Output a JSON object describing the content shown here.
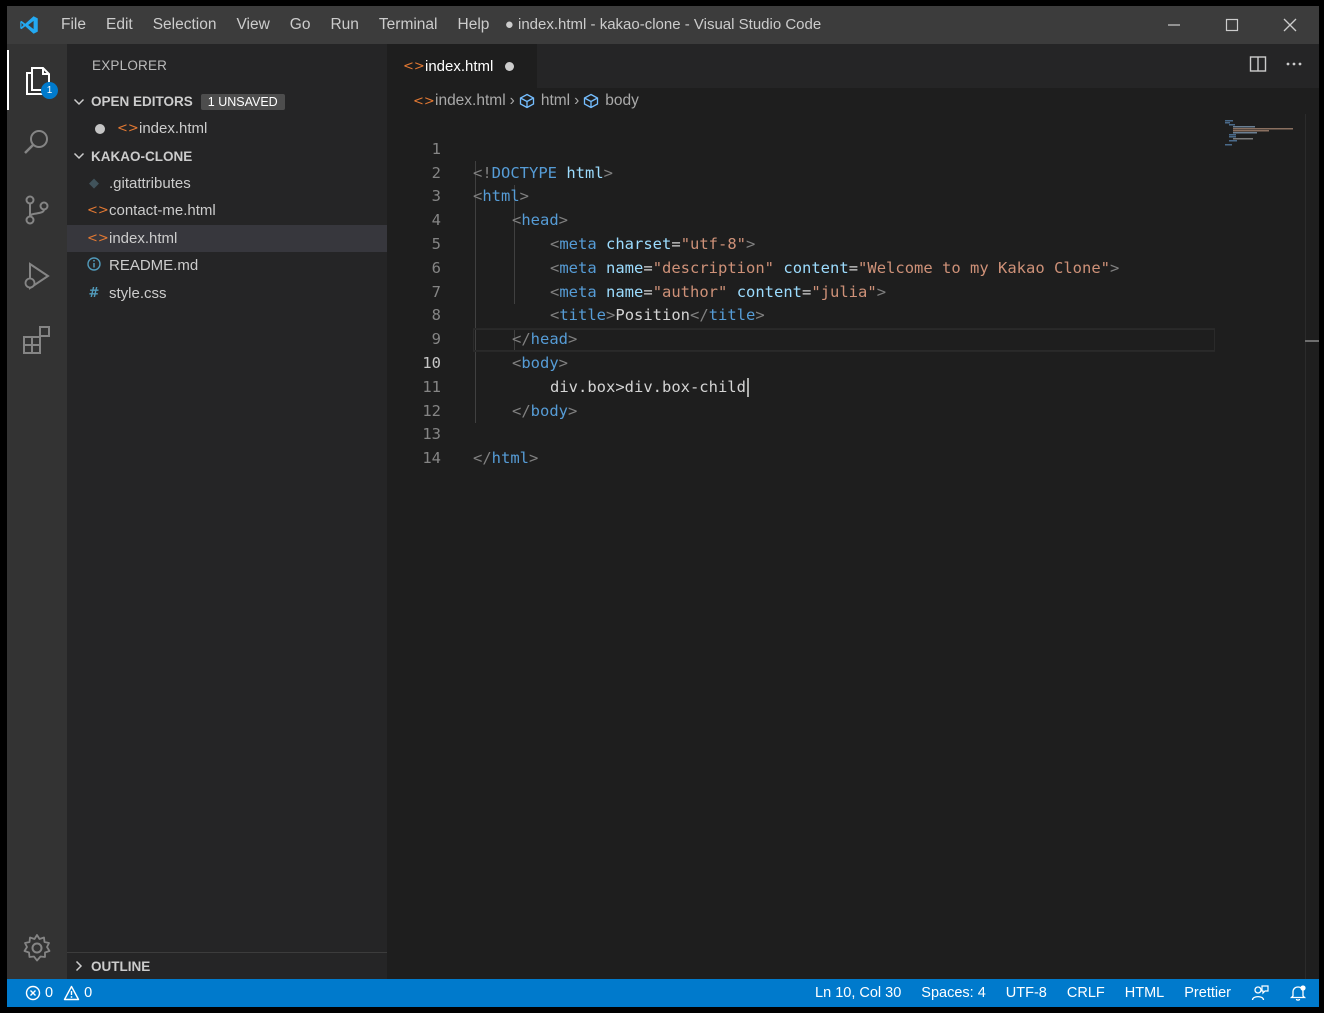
{
  "titlebar": {
    "title": "● index.html - kakao-clone - Visual Studio Code",
    "menu": [
      "File",
      "Edit",
      "Selection",
      "View",
      "Go",
      "Run",
      "Terminal",
      "Help"
    ],
    "controls": [
      "minimize-icon",
      "maximize-icon",
      "close-icon"
    ]
  },
  "activitybar": {
    "items": [
      {
        "name": "explorer-icon",
        "badge": "1",
        "active": true
      },
      {
        "name": "search-icon"
      },
      {
        "name": "source-control-icon"
      },
      {
        "name": "run-debug-icon"
      },
      {
        "name": "extensions-icon"
      }
    ],
    "bottom": {
      "name": "settings-gear-icon"
    }
  },
  "sidebar": {
    "title": "EXPLORER",
    "open_editors": {
      "label": "OPEN EDITORS",
      "badge": "1 UNSAVED",
      "items": [
        {
          "name": "index.html",
          "icon": "html-icon",
          "modified": true
        }
      ]
    },
    "project": {
      "label": "KAKAO-CLONE",
      "files": [
        {
          "name": ".gitattributes",
          "icon": "git-icon",
          "color": "#41535b"
        },
        {
          "name": "contact-me.html",
          "icon": "html-icon",
          "color": "#e37933"
        },
        {
          "name": "index.html",
          "icon": "html-icon",
          "color": "#e37933",
          "selected": true
        },
        {
          "name": "README.md",
          "icon": "info-icon",
          "color": "#519aba"
        },
        {
          "name": "style.css",
          "icon": "css-icon",
          "color": "#519aba"
        }
      ]
    },
    "outline": {
      "label": "OUTLINE"
    }
  },
  "editor": {
    "tab": {
      "label": "index.html",
      "modified": true
    },
    "breadcrumb": [
      "index.html",
      "html",
      "body"
    ],
    "current_line": 10,
    "lines": [
      {
        "n": "1"
      },
      {
        "n": "2"
      },
      {
        "n": "3"
      },
      {
        "n": "4"
      },
      {
        "n": "5"
      },
      {
        "n": "6"
      },
      {
        "n": "7"
      },
      {
        "n": "8"
      },
      {
        "n": "9"
      },
      {
        "n": "10"
      },
      {
        "n": "11"
      },
      {
        "n": "12"
      },
      {
        "n": "13"
      },
      {
        "n": "14"
      }
    ],
    "code": {
      "l1": [
        "<!",
        "DOCTYPE",
        " ",
        "html",
        ">"
      ],
      "l2": [
        "<",
        "html",
        ">"
      ],
      "l3": [
        "<",
        "head",
        ">"
      ],
      "l4": [
        "<",
        "meta",
        " ",
        "charset",
        "=",
        "\"utf-8\"",
        ">"
      ],
      "l5": [
        "<",
        "meta",
        " ",
        "name",
        "=",
        "\"description\"",
        " ",
        "content",
        "=",
        "\"Welcome to my Kakao Clone\"",
        ">"
      ],
      "l6": [
        "<",
        "meta",
        " ",
        "name",
        "=",
        "\"author\"",
        " ",
        "content",
        "=",
        "\"julia\"",
        ">"
      ],
      "l7": [
        "<",
        "title",
        ">",
        "Position",
        "</",
        "title",
        ">"
      ],
      "l8": [
        "</",
        "head",
        ">"
      ],
      "l9": [
        "<",
        "body",
        ">"
      ],
      "l10": [
        "div.box>div.box-child"
      ],
      "l11": [
        "</",
        "body",
        ">"
      ],
      "l13": [
        "</",
        "html",
        ">"
      ]
    }
  },
  "statusbar": {
    "errors": "0",
    "warnings": "0",
    "position": "Ln 10, Col 30",
    "spaces": "Spaces: 4",
    "encoding": "UTF-8",
    "eol": "CRLF",
    "language": "HTML",
    "formatter": "Prettier",
    "icons": [
      "feedback-icon",
      "notifications-bell-icon"
    ]
  },
  "colors": {
    "accent": "#007acc",
    "tag": "#569cd6",
    "attribute": "#9cdcfe",
    "string": "#ce9178",
    "html_file": "#e37933"
  }
}
